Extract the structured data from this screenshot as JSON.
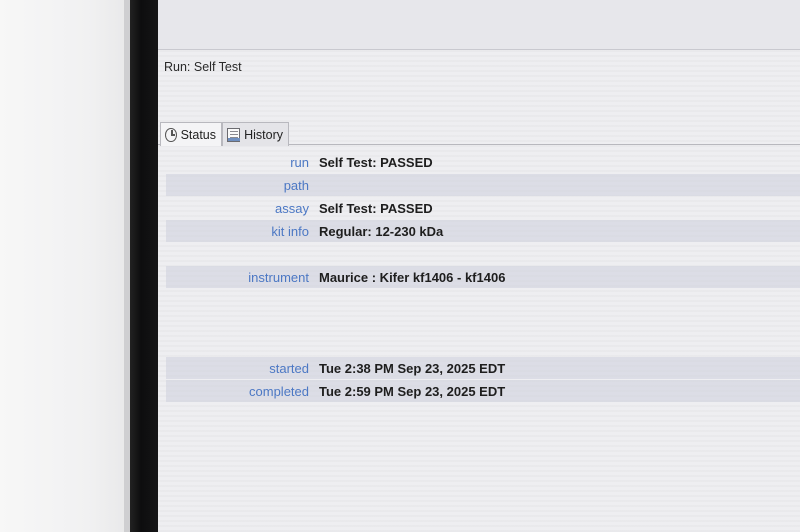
{
  "header": {
    "run_label": "Run:  Self Test"
  },
  "tabs": [
    {
      "label": "Status",
      "icon": "clock-icon",
      "active": true
    },
    {
      "label": "History",
      "icon": "history-icon",
      "active": false
    }
  ],
  "status": {
    "run": {
      "label": "run",
      "value": "Self Test: PASSED"
    },
    "path": {
      "label": "path",
      "value": ""
    },
    "assay": {
      "label": "assay",
      "value": "Self Test: PASSED"
    },
    "kit_info": {
      "label": "kit info",
      "value": "Regular: 12-230 kDa"
    },
    "instrument": {
      "label": "instrument",
      "value": "Maurice : Kifer kf1406 - kf1406"
    },
    "started": {
      "label": "started",
      "value": "Tue 2:38 PM Sep 23, 2025 EDT"
    },
    "completed": {
      "label": "completed",
      "value": "Tue 2:59 PM Sep 23, 2025 EDT"
    }
  },
  "colors": {
    "label_blue": "#4c78c4",
    "value_text": "#1e1e1e",
    "row_shade": "#cdcfdc"
  }
}
